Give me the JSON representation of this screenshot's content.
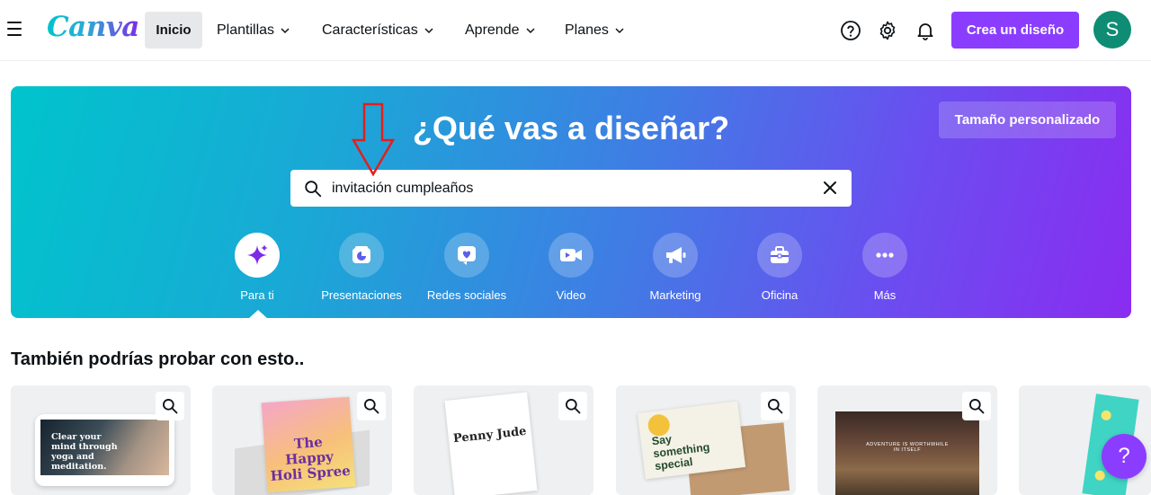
{
  "header": {
    "logo": "Canva",
    "nav": [
      {
        "label": "Inicio",
        "has_dropdown": false,
        "active": true
      },
      {
        "label": "Plantillas",
        "has_dropdown": true
      },
      {
        "label": "Características",
        "has_dropdown": true
      },
      {
        "label": "Aprende",
        "has_dropdown": true
      },
      {
        "label": "Planes",
        "has_dropdown": true
      }
    ],
    "icons": [
      "help-icon",
      "gear-icon",
      "bell-icon"
    ],
    "create_button": "Crea un diseño",
    "avatar_initial": "S"
  },
  "hero": {
    "title": "¿Qué vas a diseñar?",
    "custom_size_button": "Tamaño personalizado",
    "search": {
      "value": "invitación cumpleaños",
      "placeholder": ""
    },
    "categories": [
      {
        "label": "Para ti",
        "icon": "sparkle-icon",
        "active": true
      },
      {
        "label": "Presentaciones",
        "icon": "presentation-icon"
      },
      {
        "label": "Redes sociales",
        "icon": "heart-icon"
      },
      {
        "label": "Video",
        "icon": "video-icon"
      },
      {
        "label": "Marketing",
        "icon": "megaphone-icon"
      },
      {
        "label": "Oficina",
        "icon": "briefcase-icon"
      },
      {
        "label": "Más",
        "icon": "more-icon"
      }
    ]
  },
  "suggestions": {
    "title": "También podrías probar con esto..",
    "cards": [
      {
        "text": "Clear your mind through yoga and meditation."
      },
      {
        "text": "The Happy Holi Spree"
      },
      {
        "text": "Penny Jude"
      },
      {
        "text": "Say something special"
      },
      {
        "text": "ADVENTURE IS WORTHWHILE IN ITSELF"
      },
      {
        "text": ""
      }
    ]
  },
  "floating_help": "?",
  "colors": {
    "brand_purple": "#8b3dff",
    "avatar_green": "#0e8c74",
    "annotation_red": "#e0201c"
  }
}
